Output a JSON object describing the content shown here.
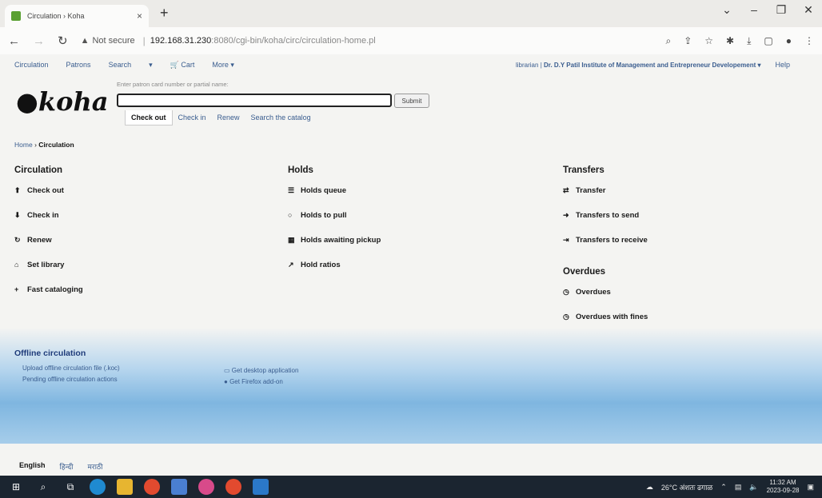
{
  "browser": {
    "tab_title": "Circulation › Koha",
    "tab_close": "×",
    "new_tab": "+",
    "security_label": "Not secure",
    "url_host": "192.168.31.230",
    "url_rest": ":8080/cgi-bin/koha/circ/circulation-home.pl",
    "window_controls": [
      "⌄",
      "–",
      "❐",
      "✕"
    ]
  },
  "koha_nav": {
    "items": [
      "Circulation",
      "Patrons",
      "Search",
      "▾",
      "🛒 Cart",
      "More ▾"
    ],
    "user": "librarian",
    "separator": "|",
    "library": "Dr. D.Y Patil Institute of Management and Entrepreneur Developement ▾",
    "help": "Help"
  },
  "logo": "koha",
  "search": {
    "hint": "Enter patron card number or partial name:",
    "submit": "Submit",
    "tabs": [
      "Check out",
      "Check in",
      "Renew",
      "Search the catalog"
    ]
  },
  "breadcrumb": {
    "home": "Home",
    "sep": "›",
    "current": "Circulation"
  },
  "columns": {
    "circulation": {
      "title": "Circulation",
      "items": [
        {
          "icon": "⬆",
          "label": "Check out"
        },
        {
          "icon": "⬇",
          "label": "Check in"
        },
        {
          "icon": "↻",
          "label": "Renew"
        },
        {
          "icon": "⌂",
          "label": "Set library"
        },
        {
          "icon": "+",
          "label": "Fast cataloging"
        }
      ]
    },
    "holds": {
      "title": "Holds",
      "items": [
        {
          "icon": "☰",
          "label": "Holds queue"
        },
        {
          "icon": "○",
          "label": "Holds to pull"
        },
        {
          "icon": "▦",
          "label": "Holds awaiting pickup"
        },
        {
          "icon": "↗",
          "label": "Hold ratios"
        }
      ]
    },
    "transfers": {
      "title": "Transfers",
      "items": [
        {
          "icon": "⇄",
          "label": "Transfer"
        },
        {
          "icon": "➜",
          "label": "Transfers to send"
        },
        {
          "icon": "⇥",
          "label": "Transfers to receive"
        }
      ]
    },
    "overdues": {
      "title": "Overdues",
      "items": [
        {
          "icon": "◷",
          "label": "Overdues"
        },
        {
          "icon": "◷",
          "label": "Overdues with fines"
        }
      ]
    }
  },
  "offline": {
    "title": "Offline circulation",
    "links_left": [
      "Upload offline circulation file (.koc)",
      "Pending offline circulation actions"
    ],
    "links_right": [
      "Get desktop application",
      "Get Firefox add-on"
    ]
  },
  "languages": {
    "current": "English",
    "others": [
      "हिन्दी",
      "मराठी"
    ]
  },
  "taskbar": {
    "weather": "26°C अंशतः ढगाळ",
    "time": "11:32 AM",
    "date": "2023-09-28"
  }
}
